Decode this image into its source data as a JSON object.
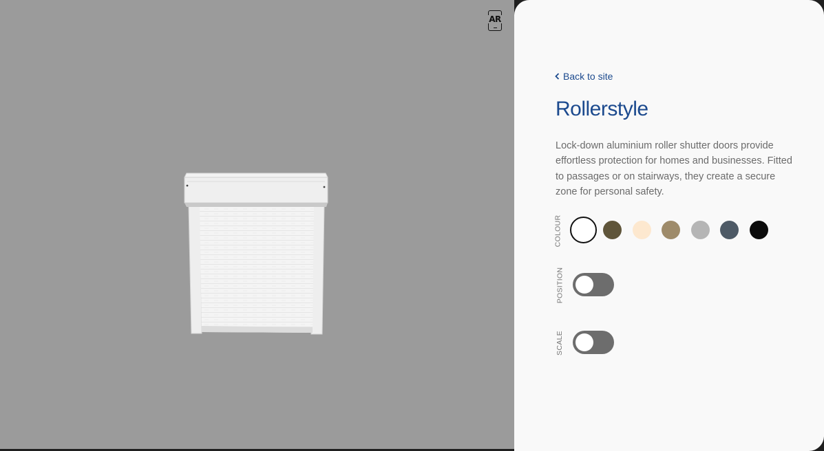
{
  "viewer": {
    "ar_button_label": "AR"
  },
  "panel": {
    "back_link": "Back to site",
    "title": "Rollerstyle",
    "description": "Lock-down aluminium roller shutter doors provide effortless protection for homes and businesses. Fitted to passages or on stairways, they create a secure zone for personal safety.",
    "colour": {
      "label": "COLOUR",
      "swatches": [
        {
          "name": "white",
          "hex": "#ffffff",
          "selected": true
        },
        {
          "name": "olive-brown",
          "hex": "#5f553a",
          "selected": false
        },
        {
          "name": "cream",
          "hex": "#fde8cf",
          "selected": false
        },
        {
          "name": "sand",
          "hex": "#9e8b6a",
          "selected": false
        },
        {
          "name": "light-grey",
          "hex": "#b5b5b5",
          "selected": false
        },
        {
          "name": "slate-grey",
          "hex": "#4e5a66",
          "selected": false
        },
        {
          "name": "black",
          "hex": "#0c0c0c",
          "selected": false
        }
      ]
    },
    "position": {
      "label": "POSITION",
      "enabled": false
    },
    "scale": {
      "label": "SCALE",
      "enabled": false
    }
  }
}
